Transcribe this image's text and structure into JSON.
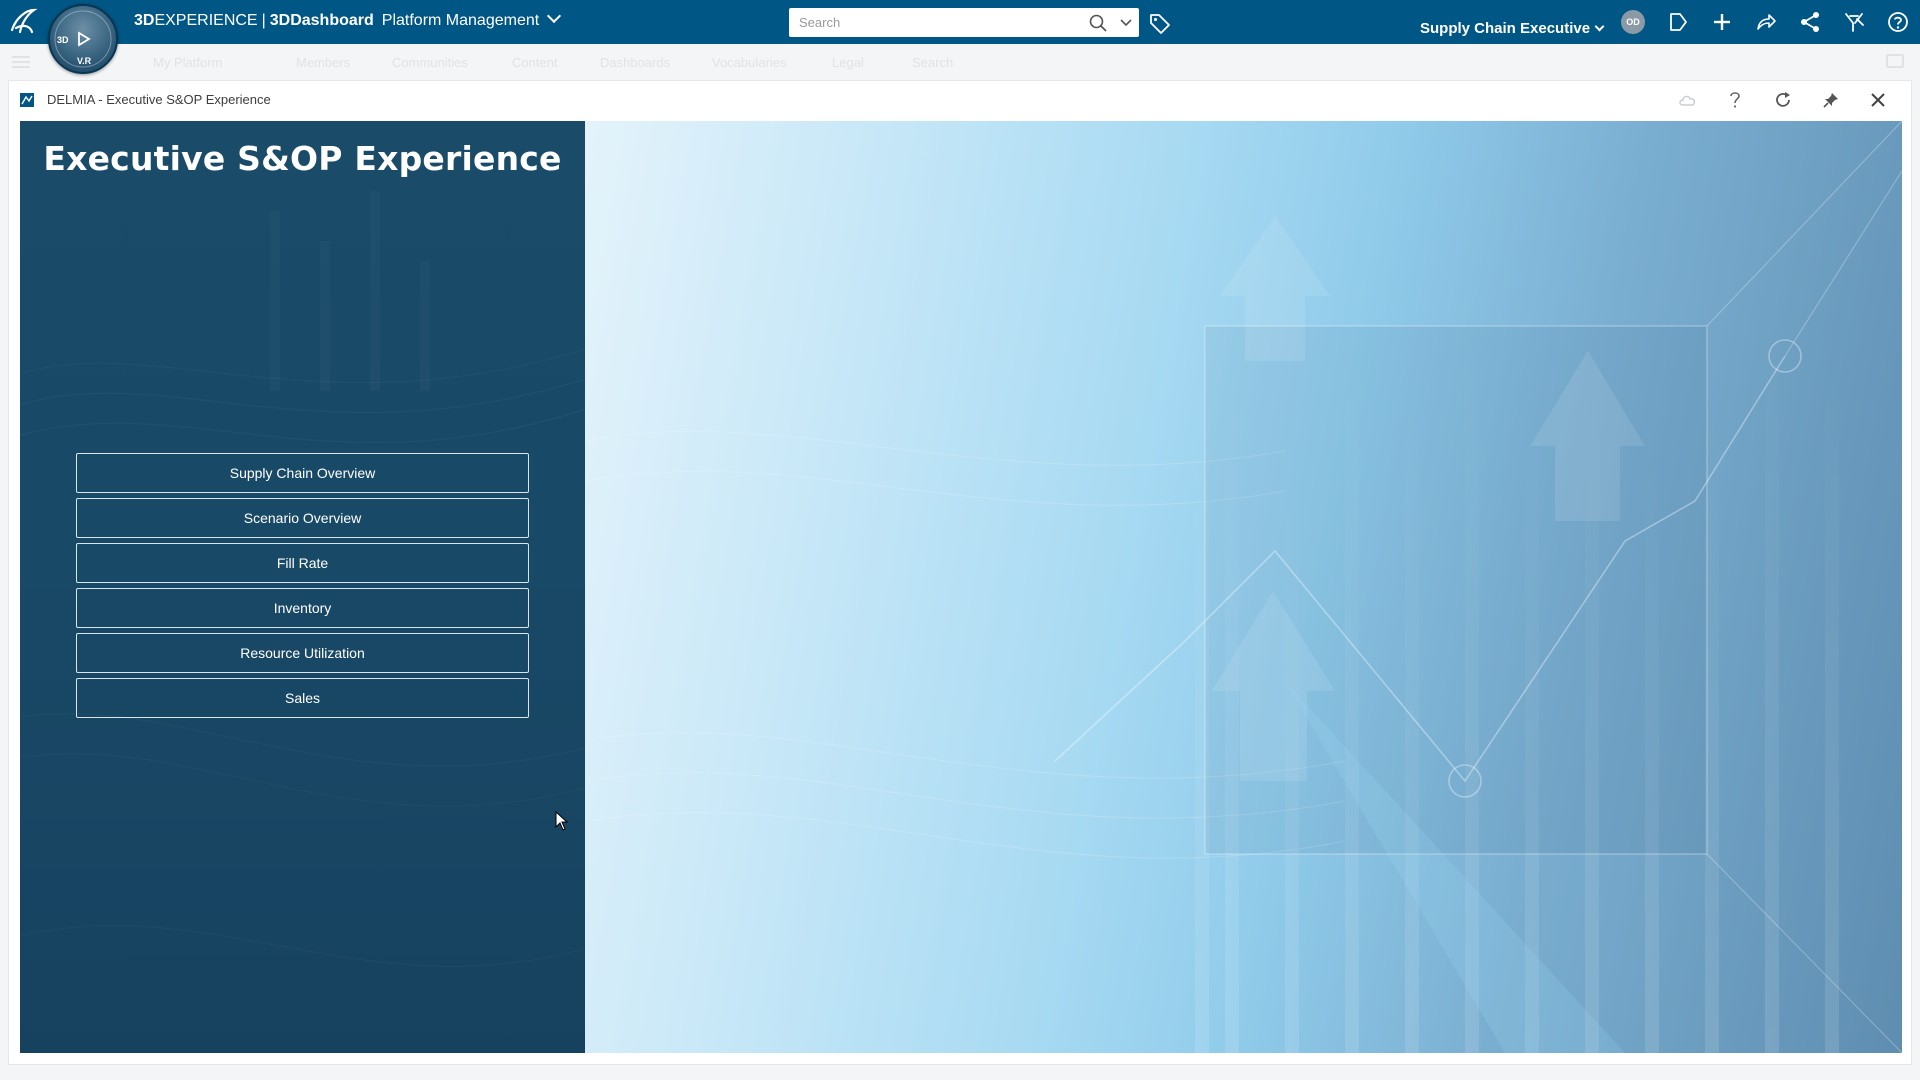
{
  "topbar": {
    "brand_strong": "3D",
    "brand_rest": "EXPERIENCE",
    "separator": "|",
    "brand_app_strong": "3DDashboard",
    "brand_app": "Platform Management",
    "compass": {
      "top_label": "3D",
      "bottom_label": "V.R"
    },
    "search": {
      "placeholder": "Search"
    },
    "role": "Supply Chain Executive",
    "avatar_initials": "OD"
  },
  "subnav": {
    "items": [
      "My Platform",
      "Members",
      "Communities",
      "Content",
      "Dashboards",
      "Vocabularies",
      "Legal",
      "Search"
    ]
  },
  "widget": {
    "title": "DELMIA - Executive S&OP Experience",
    "hero_title": "Executive S&OP Experience",
    "buttons": [
      "Supply Chain Overview",
      "Scenario Overview",
      "Fill Rate",
      "Inventory",
      "Resource Utilization",
      "Sales"
    ]
  },
  "colors": {
    "topbar": "#005685",
    "panel": "#184a68",
    "visual_light": "#c4e6f7",
    "visual_dark": "#5e8db0"
  }
}
